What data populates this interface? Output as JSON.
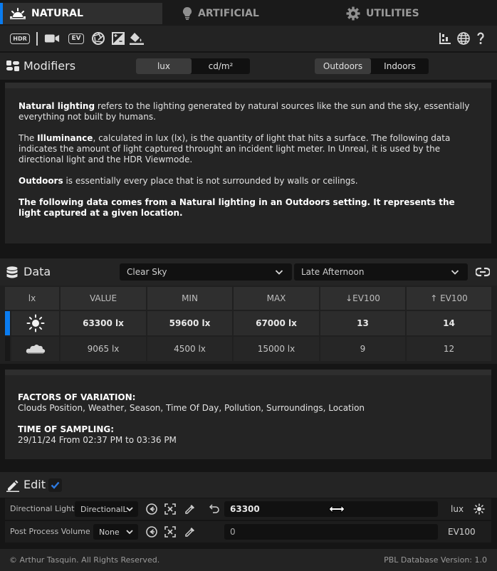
{
  "tabs": [
    {
      "label": "NATURAL",
      "icon": "sunrise-icon",
      "active": true
    },
    {
      "label": "ARTIFICIAL",
      "icon": "lightbulb-icon",
      "active": false
    },
    {
      "label": "UTILITIES",
      "icon": "gear-icon",
      "active": false
    }
  ],
  "toolbar": {
    "hdr_label": "HDR",
    "ev_label": "EV",
    "left_icons": [
      "hdr-icon",
      "camera-icon",
      "ev-icon",
      "aperture-icon",
      "exposure-icon",
      "fill-bucket-icon"
    ],
    "right_icons": [
      "chart-icon",
      "globe-icon",
      "help-icon"
    ]
  },
  "modifiers": {
    "title": "Modifiers",
    "units": {
      "options": [
        "lux",
        "cd/m²"
      ],
      "selected": "lux"
    },
    "setting": {
      "options": [
        "Outdoors",
        "Indoors"
      ],
      "selected": "Outdoors"
    },
    "description": {
      "p1_bold": "Natural lighting",
      "p1_text": " refers to the lighting generated by natural sources like the sun and the sky, essentially everything not built by humans.",
      "p2_pre": "The ",
      "p2_bold": "Illuminance",
      "p2_text": ", calculated in lux (lx), is the quantity of light that hits a surface. The following data indicates the amount of light captured throught an incident light meter. In Unreal, it is used by the directional light and the HDR Viewmode.",
      "p3_bold": "Outdoors",
      "p3_text": " is essentially every place that is not surrounded by walls or ceilings.",
      "p4_bold": "The following data comes from a Natural lighting in an Outdoors setting. It represents the light captured at a given location."
    }
  },
  "data_section": {
    "title": "Data",
    "sky_dropdown": "Clear Sky",
    "time_dropdown": "Late Afternoon",
    "table": {
      "headers": [
        "lx",
        "VALUE",
        "MIN",
        "MAX",
        "↓EV100",
        "↑ EV100"
      ],
      "rows": [
        {
          "icon": "sun-icon",
          "value": "63300 lx",
          "min": "59600 lx",
          "max": "67000 lx",
          "ev_low": "13",
          "ev_high": "14",
          "selected": true
        },
        {
          "icon": "cloud-icon",
          "value": "9065 lx",
          "min": "4500 lx",
          "max": "15000 lx",
          "ev_low": "9",
          "ev_high": "12",
          "selected": false
        }
      ]
    },
    "factors_title": "FACTORS OF VARIATION:",
    "factors_text": "Clouds Position, Weather, Season, Time Of Day, Pollution, Surroundings, Location",
    "sampling_title": "TIME OF SAMPLING:",
    "sampling_text": "29/11/24 From 02:37 PM to 03:36 PM"
  },
  "edit": {
    "title": "Edit",
    "checked": true,
    "rows": [
      {
        "label": "Directional Light",
        "dropdown": "DirectionalL",
        "value": "63300",
        "unit": "lux"
      },
      {
        "label": "Post Process Volume",
        "dropdown": "None",
        "value": "0",
        "unit": "EV100"
      }
    ]
  },
  "footer": {
    "copyright": "© Arthur Tasquin. All Rights Reserved.",
    "version": "PBL Database Version: 1.0"
  },
  "colors": {
    "accent": "#0a7cf0",
    "checkbox": "#1f5fbf"
  }
}
